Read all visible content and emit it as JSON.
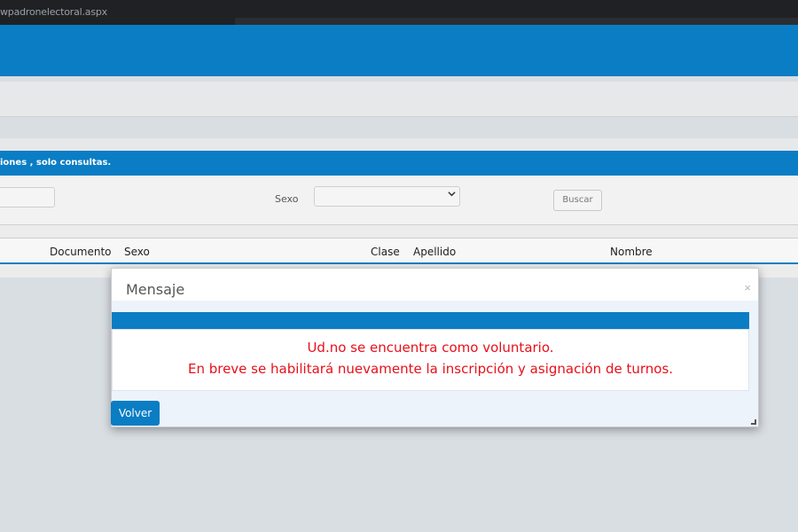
{
  "browser": {
    "url_text": "wpadronelectoral.aspx"
  },
  "panel": {
    "header_text": "iones , solo consultas.",
    "filters": {
      "sexo_label": "Sexo",
      "sexo_selected": "",
      "buscar_label": "Buscar"
    },
    "columns": [
      "Documento",
      "Sexo",
      "Clase",
      "Apellido",
      "Nombre"
    ]
  },
  "modal": {
    "title": "Mensaje",
    "close_glyph": "×",
    "message_line1": "Ud.no se encuentra como voluntario.",
    "message_line2": "En breve se habilitará nuevamente la inscripción y asignación de turnos.",
    "button_label": "Volver"
  },
  "colors": {
    "primary": "#0a7dc4",
    "error": "#e8101a",
    "background": "#d9dee3"
  },
  "icons": {
    "close": "close-icon",
    "select": "chevron-down-icon",
    "resize": "resize-handle-icon"
  }
}
